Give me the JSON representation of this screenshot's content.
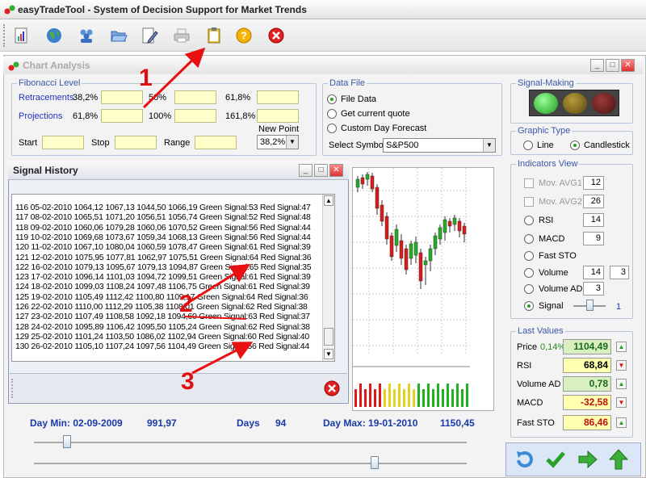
{
  "app": {
    "title": "easyTradeTool - System of Decision Support for Market Trends"
  },
  "toolbar": {
    "icons": [
      "chart-report-icon",
      "globe-icon",
      "users-icon",
      "folder-open-icon",
      "edit-icon",
      "print-icon",
      "clipboard-icon",
      "help-icon",
      "close-icon"
    ]
  },
  "window": {
    "title": "Chart Analysis"
  },
  "fibonacci": {
    "legend": "Fibonacci Level",
    "retracements_label": "Retracements",
    "ret_p1": "38,2%",
    "ret_p2": "50%",
    "ret_p3": "61,8%",
    "projections_label": "Projections",
    "proj_p1": "61,8%",
    "proj_p2": "100%",
    "proj_p3": "161,8%",
    "start_label": "Start",
    "stop_label": "Stop",
    "range_label": "Range",
    "new_point_label": "New Point",
    "new_point_value": "38,2%"
  },
  "data_file": {
    "legend": "Data File",
    "opt1": "File Data",
    "opt2": "Get current quote",
    "opt3": "Custom Day Forecast",
    "symbol_label": "Select Symbol",
    "symbol_value": "S&P500"
  },
  "signal_making": {
    "legend": "Signal-Making"
  },
  "graphic_type": {
    "legend": "Graphic Type",
    "line": "Line",
    "candlestick": "Candlestick"
  },
  "indicators": {
    "legend": "Indicators View",
    "mov1": "Mov. AVG1",
    "mov1_val": "12",
    "mov2": "Mov. AVG2",
    "mov2_val": "26",
    "rsi": "RSI",
    "rsi_val": "14",
    "macd": "MACD",
    "macd_val": "9",
    "faststo": "Fast STO",
    "volume": "Volume",
    "volume_val1": "14",
    "volume_val2": "3",
    "volumead": "Volume AD",
    "volumead_val": "3",
    "signal": "Signal",
    "signal_val": "1"
  },
  "last_values": {
    "legend": "Last Values",
    "price_label": "Price",
    "price_pct": "0,14%",
    "price_val": "1104,49",
    "rsi_label": "RSI",
    "rsi_val": "68,84",
    "volad_label": "Volume AD",
    "volad_val": "0,78",
    "macd_label": "MACD",
    "macd_val": "-32,58",
    "faststo_label": "Fast STO",
    "faststo_val": "86,46",
    "colors": {
      "green": "#d8f0c0",
      "yellow": "#ffffb0"
    }
  },
  "signal_history": {
    "title": "Signal History",
    "rows": [
      "116 05-02-2010 1064,12 1067,13 1044,50 1066,19 Green Signal:53 Red Signal:47",
      "117 08-02-2010 1065,51 1071,20 1056,51 1056,74 Green Signal:52 Red Signal:48",
      "118 09-02-2010 1060,06 1079,28 1060,06 1070,52 Green Signal:56 Red Signal:44",
      "119 10-02-2010 1069,68 1073,67 1059,34 1068,13 Green Signal:56 Red Signal:44",
      "120 11-02-2010 1067,10 1080,04 1060,59 1078,47 Green Signal:61 Red Signal:39",
      "121 12-02-2010 1075,95 1077,81 1062,97 1075,51 Green Signal:64 Red Signal:36",
      "122 16-02-2010 1079,13 1095,67 1079,13 1094,87 Green Signal:65 Red Signal:35",
      "123 17-02-2010 1096,14 1101,03 1094,72 1099,51 Green Signal:61 Red Signal:39",
      "124 18-02-2010 1099,03 1108,24 1097,48 1106,75 Green Signal:61 Red Signal:39",
      "125 19-02-2010 1105,49 1112,42 1100,80 1109,17 Green Signal:64 Red Signal:36",
      "126 22-02-2010 1110,00 1112,29 1105,38 1108,01 Green Signal:62 Red Signal:38",
      "127 23-02-2010 1107,49 1108,58 1092,18 1094,60 Green Signal:63 Red Signal:37",
      "128 24-02-2010 1095,89 1106,42 1095,50 1105,24 Green Signal:62 Red Signal:38",
      "129 25-02-2010 1101,24 1103,50 1086,02 1102,94 Green Signal:60 Red Signal:40",
      "130 26-02-2010 1105,10 1107,24 1097,56 1104,49 Green Signal:56 Red Signal:44"
    ]
  },
  "annotations": {
    "n1": "1",
    "n2": "2",
    "n3": "3"
  },
  "bottom": {
    "day_min": "Day Min: 02-09-2009",
    "day_min_val": "991,97",
    "days_label": "Days",
    "days_val": "94",
    "day_max": "Day Max: 19-01-2010",
    "day_max_val": "1150,45"
  }
}
